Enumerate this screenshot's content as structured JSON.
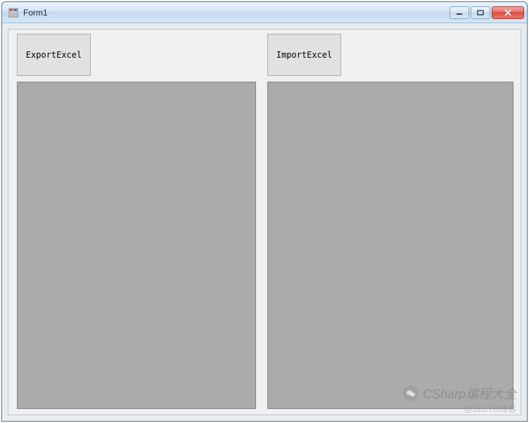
{
  "window": {
    "title": "Form1"
  },
  "buttons": {
    "export_label": "ExportExcel",
    "import_label": "ImportExcel"
  },
  "watermark": {
    "main": "CSharp编程大全",
    "sub": "@51CTO博客"
  }
}
